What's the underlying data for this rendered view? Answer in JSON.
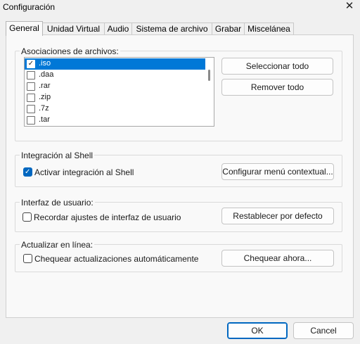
{
  "window": {
    "title": "Configuración"
  },
  "tabs": [
    {
      "label": "General"
    },
    {
      "label": "Unidad Virtual"
    },
    {
      "label": "Audio"
    },
    {
      "label": "Sistema de archivo"
    },
    {
      "label": "Grabar"
    },
    {
      "label": "Miscelánea"
    }
  ],
  "file_assoc": {
    "group_label": "Asociaciones de archivos:",
    "items": [
      {
        "label": ".iso",
        "checked": true,
        "selected": true
      },
      {
        "label": ".daa",
        "checked": false,
        "selected": false
      },
      {
        "label": ".rar",
        "checked": false,
        "selected": false
      },
      {
        "label": ".zip",
        "checked": false,
        "selected": false
      },
      {
        "label": ".7z",
        "checked": false,
        "selected": false
      },
      {
        "label": ".tar",
        "checked": false,
        "selected": false
      }
    ],
    "select_all": "Seleccionar todo",
    "remove_all": "Remover todo"
  },
  "shell": {
    "group_label": "Integración al Shell",
    "checkbox_label": "Activar integración al Shell",
    "checked": true,
    "button": "Configurar menú contextual..."
  },
  "ui": {
    "group_label": "Interfaz de usuario:",
    "checkbox_label": "Recordar ajustes de interfaz de usuario",
    "checked": false,
    "button": "Restablecer por defecto"
  },
  "update": {
    "group_label": "Actualizar en línea:",
    "checkbox_label": "Chequear actualizaciones automáticamente",
    "checked": false,
    "button": "Chequear ahora..."
  },
  "footer": {
    "ok": "OK",
    "cancel": "Cancel"
  },
  "icons": {
    "close": "close-icon",
    "check": "check-icon"
  }
}
